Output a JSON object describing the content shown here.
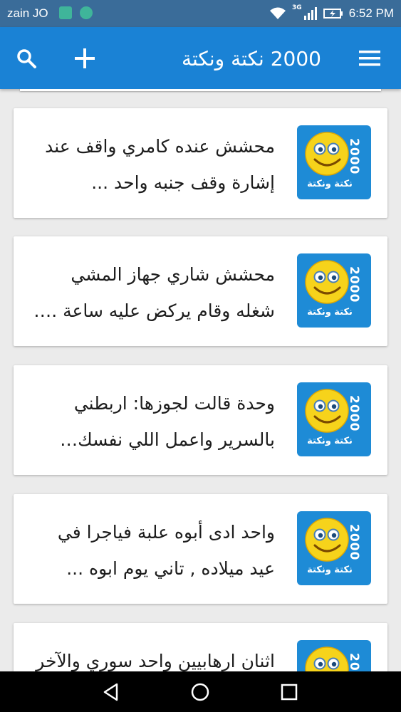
{
  "status_bar": {
    "carrier": "zain JO",
    "network": "3G",
    "time": "6:52 PM"
  },
  "app_bar": {
    "title": "2000 نكتة ونكتة",
    "color": "#1a82d5",
    "icons": [
      "menu-icon",
      "add-icon",
      "search-icon"
    ]
  },
  "thumbnail": {
    "number": "2000",
    "caption": "نكتة ونكتة"
  },
  "jokes": [
    {
      "text": "محشش عنده كامري  واقف عند إشارة   وقف جنبه واحد ..."
    },
    {
      "text": "محشش شاري جهاز المشي شغله وقام يركض عليه ساعة .. سا..."
    },
    {
      "text": "وحدة قالت لجوزها: اربطني بالسرير واعمل اللي نفسك في..."
    },
    {
      "text": "واحد ادى أبوه علبة فياجرا في عيد ميلاده , تاني يوم ابوه ..."
    },
    {
      "text": "اثنان ارهابيين واحد سوري والآخر"
    }
  ],
  "nav_bar": {
    "icons": [
      "back-icon",
      "home-icon",
      "recents-icon"
    ]
  }
}
